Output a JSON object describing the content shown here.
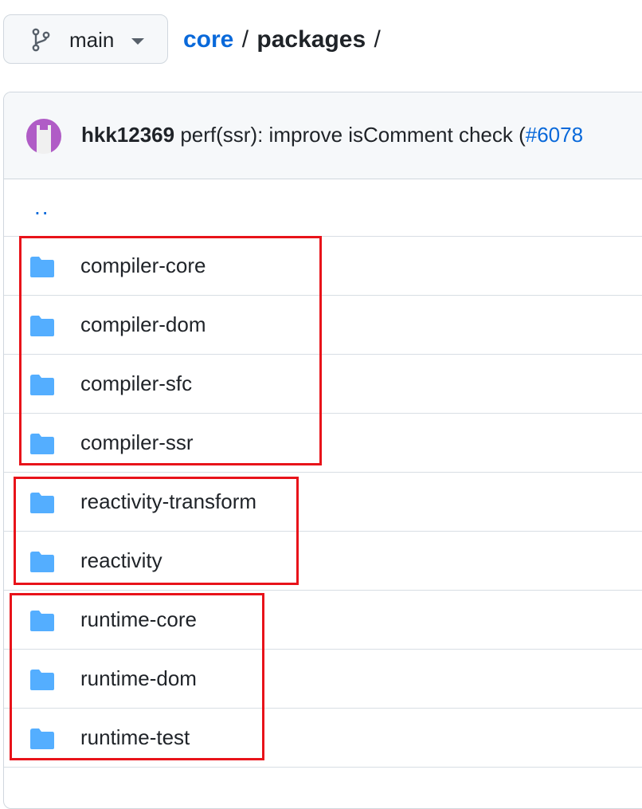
{
  "branch": {
    "label": "main"
  },
  "breadcrumb": {
    "repo": "core",
    "sep1": "/",
    "folder": "packages",
    "sep2": "/"
  },
  "commit": {
    "author": "hkk12369",
    "message_pre": " perf(ssr): improve isComment check (",
    "pr": "#6078"
  },
  "parent_link": "..",
  "files": [
    {
      "name": "compiler-core"
    },
    {
      "name": "compiler-dom"
    },
    {
      "name": "compiler-sfc"
    },
    {
      "name": "compiler-ssr"
    },
    {
      "name": "reactivity-transform"
    },
    {
      "name": "reactivity"
    },
    {
      "name": "runtime-core"
    },
    {
      "name": "runtime-dom"
    },
    {
      "name": "runtime-test"
    }
  ],
  "colors": {
    "folder": "#54aeff",
    "link": "#0969da",
    "highlight": "#e8131a"
  }
}
